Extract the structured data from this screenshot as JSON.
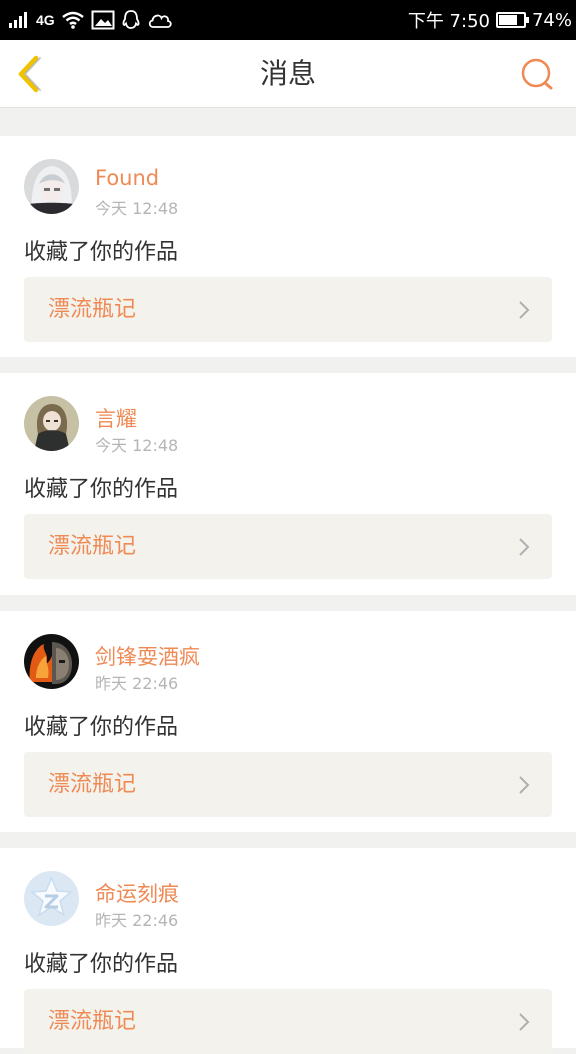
{
  "status_bar": {
    "network": "4G",
    "time": "下午 7:50",
    "battery": "74%",
    "battery_level": 0.74
  },
  "header": {
    "title": "消息"
  },
  "messages": [
    {
      "username": "Found",
      "time": "今天 12:48",
      "action": "收藏了你的作品",
      "work_title": "漂流瓶记"
    },
    {
      "username": "言耀",
      "time": "今天 12:48",
      "action": "收藏了你的作品",
      "work_title": "漂流瓶记"
    },
    {
      "username": "剑锋耍酒疯",
      "time": "昨天 22:46",
      "action": "收藏了你的作品",
      "work_title": "漂流瓶记"
    },
    {
      "username": "命运刻痕",
      "time": "昨天 22:46",
      "action": "收藏了你的作品",
      "work_title": "漂流瓶记"
    }
  ],
  "colors": {
    "accent": "#ef8a55",
    "back_arrow": "#f0c300",
    "card_link_bg": "#f3f2ec",
    "page_bg": "#f1f1ef"
  },
  "icons": [
    "signal-icon",
    "wifi-icon",
    "image-icon",
    "qq-icon",
    "cloud-icon",
    "back-arrow-icon",
    "search-icon",
    "chevron-right-icon",
    "avatar"
  ]
}
